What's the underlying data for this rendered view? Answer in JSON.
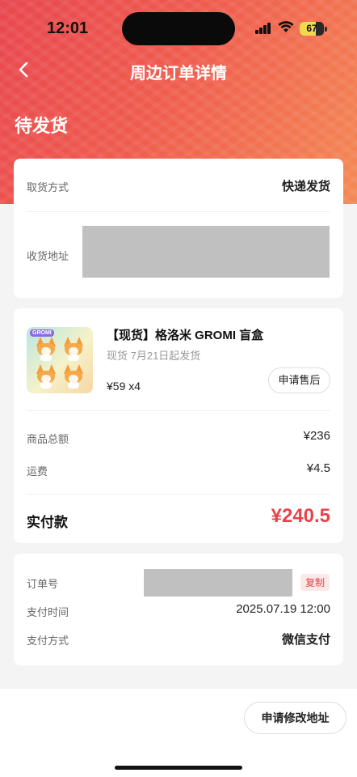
{
  "status_bar": {
    "time": "12:01",
    "battery": "67",
    "battery_level": 0.67
  },
  "header": {
    "title": "周边订单详情",
    "order_status": "待发货"
  },
  "delivery": {
    "pickup_label": "取货方式",
    "pickup_value": "快递发货",
    "address_label": "收货地址"
  },
  "product": {
    "logo_text": "GROMI",
    "title": "【现货】格洛米 GROMI 盲盒",
    "subtitle": "现货 7月21日起发货",
    "price_qty": "¥59 x4",
    "after_sale_button": "申请售后"
  },
  "summary": {
    "goods_total_label": "商品总额",
    "goods_total_value": "¥236",
    "shipping_label": "运费",
    "shipping_value": "¥4.5",
    "paid_label": "实付款",
    "paid_value": "¥240.5"
  },
  "order_info": {
    "order_no_label": "订单号",
    "copy_button": "复制",
    "pay_time_label": "支付时间",
    "pay_time_value": "2025.07.19 12:00",
    "pay_method_label": "支付方式",
    "pay_method_value": "微信支付"
  },
  "footer": {
    "modify_address_button": "申请修改地址"
  },
  "colors": {
    "accent": "#e8434a",
    "header_start": "#e8474f",
    "header_end": "#f48a55"
  },
  "icons": {
    "back": "chevron-left-icon",
    "signal": "cellular-signal-icon",
    "wifi": "wifi-icon",
    "battery": "battery-icon"
  }
}
